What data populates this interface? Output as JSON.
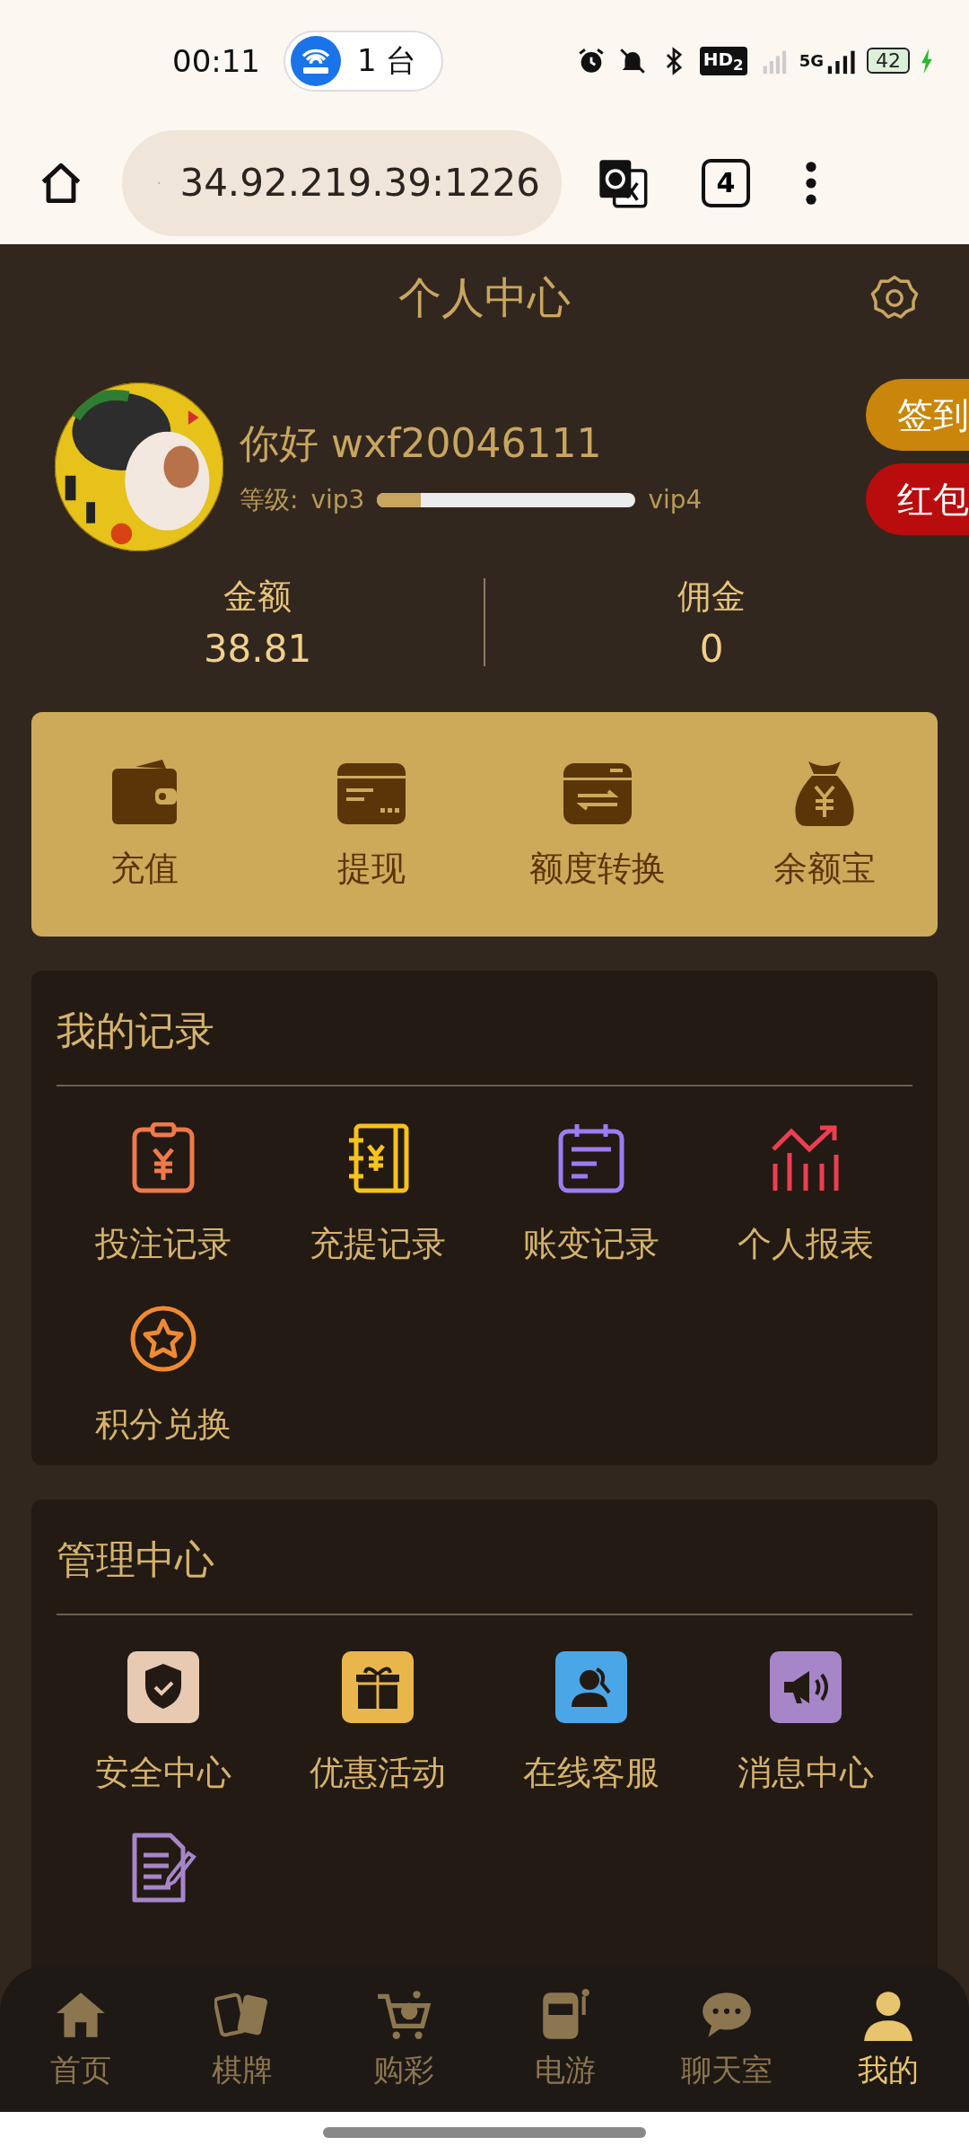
{
  "status_bar": {
    "time": "00:11",
    "hotspot": "1 台",
    "hd": "HD$_{2}$",
    "network": "5G",
    "battery": "42"
  },
  "browser": {
    "url": "34.92.219.39:1226",
    "tabs_count": "4"
  },
  "header": {
    "title": "个人中心"
  },
  "profile": {
    "greeting": "你好 wxf20046111",
    "level_label": "等级:",
    "current_level": "vip3",
    "next_level": "vip4",
    "level": 0.17
  },
  "side_buttons": [
    {
      "label": "签到",
      "color": "#c9860a"
    },
    {
      "label": "红包",
      "color": "#b90d0d"
    }
  ],
  "balances": [
    {
      "label": "金额",
      "value": "38.81"
    },
    {
      "label": "佣金",
      "value": "0"
    }
  ],
  "wallet_actions": [
    {
      "label": "充值"
    },
    {
      "label": "提现"
    },
    {
      "label": "额度转换"
    },
    {
      "label": "余额宝"
    }
  ],
  "records": {
    "title": "我的记录",
    "items": [
      {
        "label": "投注记录"
      },
      {
        "label": "充提记录"
      },
      {
        "label": "账变记录"
      },
      {
        "label": "个人报表"
      },
      {
        "label": "积分兑换"
      }
    ]
  },
  "management": {
    "title": "管理中心",
    "items": [
      {
        "label": "安全中心"
      },
      {
        "label": "优惠活动"
      },
      {
        "label": "在线客服"
      },
      {
        "label": "消息中心"
      }
    ]
  },
  "bottom_nav": [
    {
      "label": "首页",
      "selected": false
    },
    {
      "label": "棋牌",
      "selected": false
    },
    {
      "label": "购彩",
      "selected": false
    },
    {
      "label": "电游",
      "selected": false
    },
    {
      "label": "聊天室",
      "selected": false
    },
    {
      "label": "我的",
      "selected": true
    }
  ]
}
